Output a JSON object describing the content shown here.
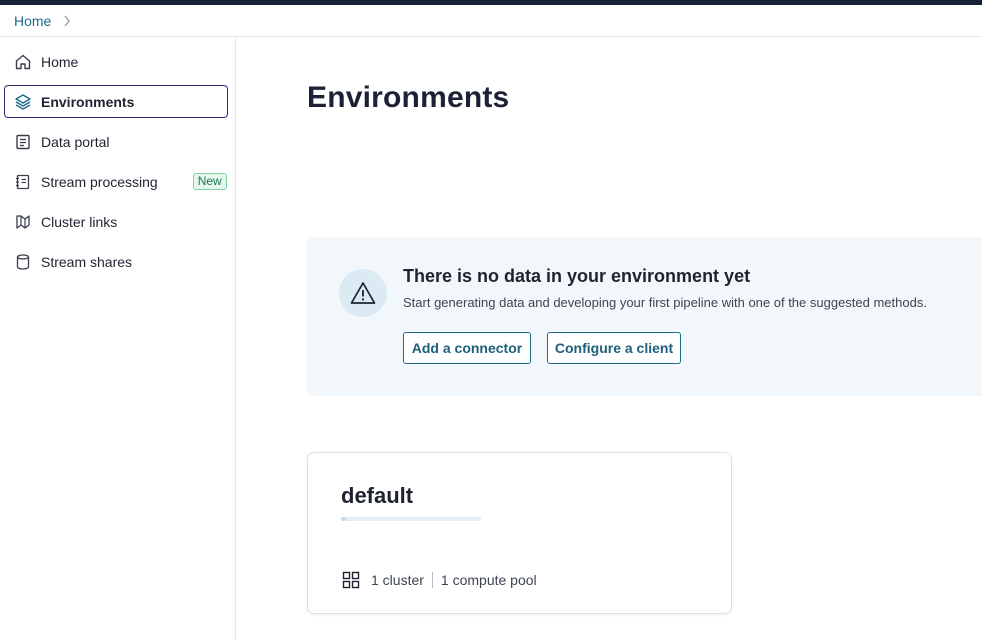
{
  "breadcrumb": {
    "items": [
      "Home"
    ]
  },
  "sidebar": {
    "items": [
      {
        "label": "Home",
        "icon": "home-icon"
      },
      {
        "label": "Environments",
        "icon": "layers-icon",
        "active": true
      },
      {
        "label": "Data portal",
        "icon": "document-icon"
      },
      {
        "label": "Stream processing",
        "icon": "notebook-icon",
        "badge": "New"
      },
      {
        "label": "Cluster links",
        "icon": "cluster-link-icon"
      },
      {
        "label": "Stream shares",
        "icon": "database-icon"
      }
    ]
  },
  "main": {
    "title": "Environments",
    "empty_state": {
      "icon": "warning-icon",
      "title": "There is no data in your environment yet",
      "description": "Start generating data and developing your first pipeline with one of the suggested methods.",
      "buttons": {
        "add_connector": "Add a connector",
        "configure_client": "Configure a client"
      }
    },
    "environment_card": {
      "name": "default",
      "icon": "grid-icon",
      "clusters": "1 cluster",
      "compute_pools": "1 compute pool"
    }
  },
  "colors": {
    "top_bar": "#162136",
    "accent": "#1e6b8a",
    "active_border": "#2a2f7a",
    "banner_bg": "#f1f7fb",
    "badge_bg": "#e6f7ee",
    "badge_text": "#1f7a4d"
  }
}
